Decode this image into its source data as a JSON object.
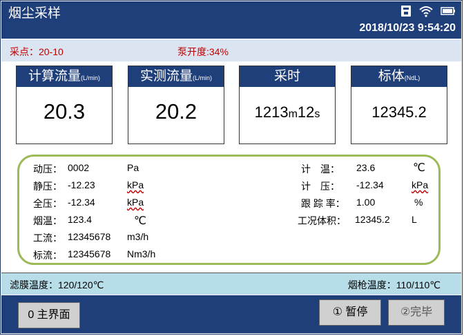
{
  "header": {
    "title": "烟尘采样",
    "datetime": "2018/10/23 9:54:20",
    "icons": [
      "usb-icon",
      "wifi-icon",
      "battery-icon"
    ]
  },
  "info": {
    "sample_point": "采点：20-10",
    "pump_opening": "泵开度:34%"
  },
  "cards": {
    "calc_flow": {
      "label": "计算流量",
      "unit": "(L/min)",
      "value": "20.3"
    },
    "measured_flow": {
      "label": "实测流量",
      "unit": "(L/min)",
      "value": "20.2"
    },
    "sample_time": {
      "label": "采时",
      "min": "1213",
      "min_unit": "m",
      "sec": "12",
      "sec_unit": "s"
    },
    "std_volume": {
      "label": "标体",
      "unit": "(NdL)",
      "value": "12345.2"
    }
  },
  "details": {
    "dynamic_pressure": {
      "label": "动压：",
      "value": "0002",
      "unit": "Pa"
    },
    "static_pressure": {
      "label": "静压：",
      "value": "-12.23",
      "unit": "kPa"
    },
    "total_pressure": {
      "label": "全压：",
      "value": "-12.34",
      "unit": "kPa"
    },
    "flue_temp": {
      "label": "烟温：",
      "value": "123.4",
      "unit": "℃"
    },
    "work_flow": {
      "label": "工流：",
      "value": "12345678",
      "unit": "m3/h"
    },
    "std_flow": {
      "label": "标流：",
      "value": "12345678",
      "unit": "Nm3/h"
    },
    "meter_temp": {
      "label": "计　温：",
      "value": "23.6",
      "unit": "℃"
    },
    "meter_pressure": {
      "label": "计　压：",
      "value": "-12.34",
      "unit": "kPa"
    },
    "tracking_rate": {
      "label": "跟 踪 率：",
      "value": "1.00",
      "unit": "%"
    },
    "work_volume": {
      "label": "工况体积：",
      "value": "12345.2",
      "unit": "L"
    }
  },
  "footer": {
    "filter_temp": "滤膜温度：120/120℃",
    "gun_temp": "烟枪温度：110/110℃"
  },
  "buttons": {
    "main": "0 主界面",
    "pause": "① 暂停",
    "done": "②完毕"
  }
}
